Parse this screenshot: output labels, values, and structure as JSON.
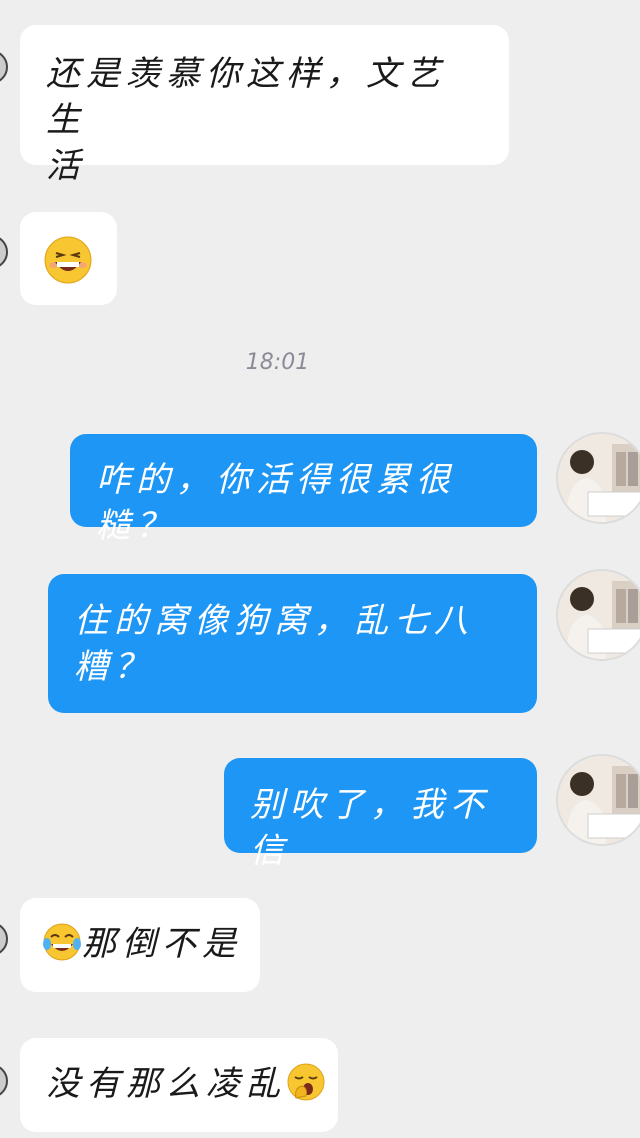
{
  "messages": [
    {
      "side": "in",
      "text": "还是羡慕你这样，文艺生活",
      "line1": "还是羡慕你这样，文艺生",
      "line2": "活"
    },
    {
      "side": "in",
      "emoji": "grinning-sweat-emoji"
    },
    {
      "side": "out",
      "text": "咋的，你活得很累很糙？"
    },
    {
      "side": "out",
      "line1": "住的窝像狗窝，乱七八",
      "line2": "糟？"
    },
    {
      "side": "out",
      "text": "别吹了，我不信"
    },
    {
      "side": "in",
      "emoji": "tears-of-joy-emoji",
      "text": "那倒不是"
    },
    {
      "side": "in",
      "text": "没有那么凌乱",
      "emoji": "yawning-emoji"
    }
  ],
  "timestamp": "18:01",
  "colors": {
    "out_bubble": "#1e96f5",
    "in_bubble": "#ffffff",
    "background": "#eeeeee"
  }
}
